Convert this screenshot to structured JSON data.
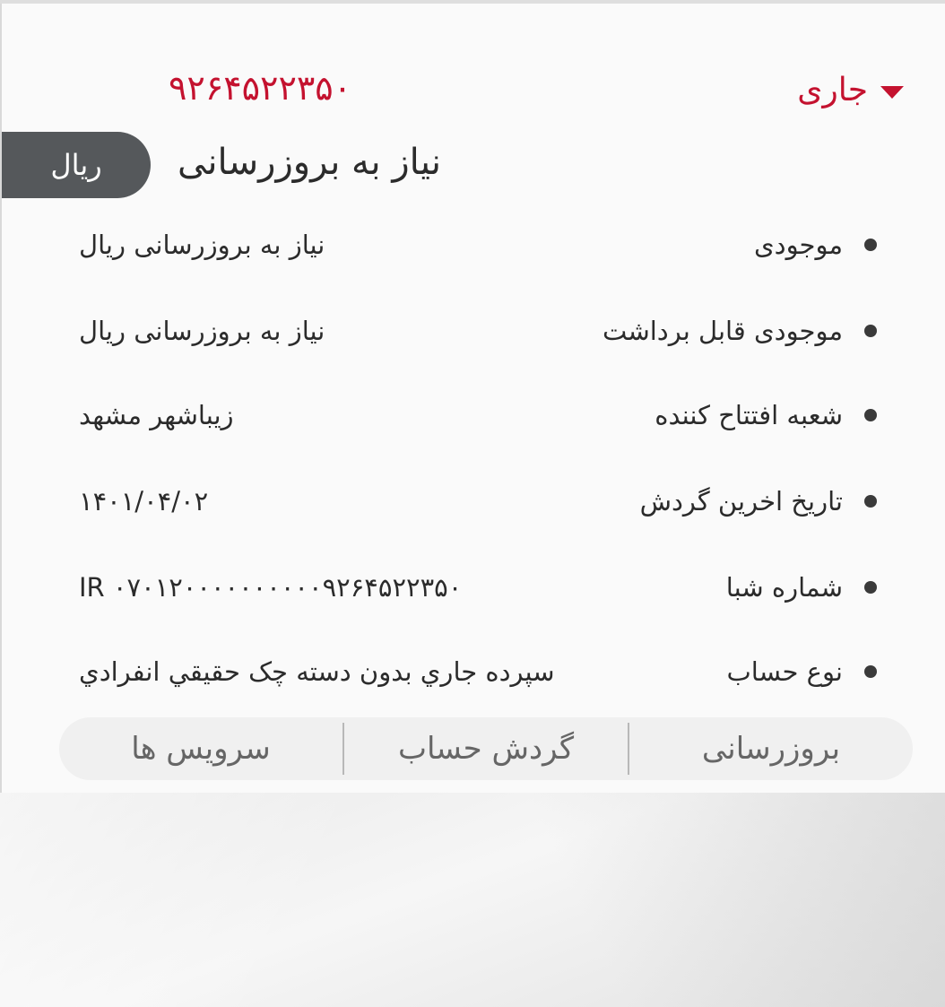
{
  "account": {
    "type_label": "جاری",
    "number": "۹۲۶۴۵۲۲۳۵۰",
    "currency": "ریال",
    "balance_status": "نیاز به بروزرسانی"
  },
  "details": [
    {
      "label": "موجودی",
      "value": "نیاز به بروزرسانی ریال"
    },
    {
      "label": "موجودی قابل برداشت",
      "value": "نیاز به بروزرسانی ریال"
    },
    {
      "label": "شعبه افتتاح کننده",
      "value": "زیباشهر مشهد"
    },
    {
      "label": "تاریخ اخرین گردش",
      "value": "۱۴۰۱/۰۴/۰۲"
    },
    {
      "label": "شماره شبا",
      "value": "IR ۰۷۰۱۲۰۰۰۰۰۰۰۰۰۰۹۲۶۴۵۲۲۳۵۰"
    },
    {
      "label": "نوع حساب",
      "value": "سپرده جاري بدون دسته چک حقيقي انفرادي"
    }
  ],
  "actions": {
    "refresh": "بروزرسانی",
    "turnover": "گردش حساب",
    "services": "سرویس ها"
  },
  "colors": {
    "accent": "#c4122f",
    "pill": "#55585b"
  }
}
